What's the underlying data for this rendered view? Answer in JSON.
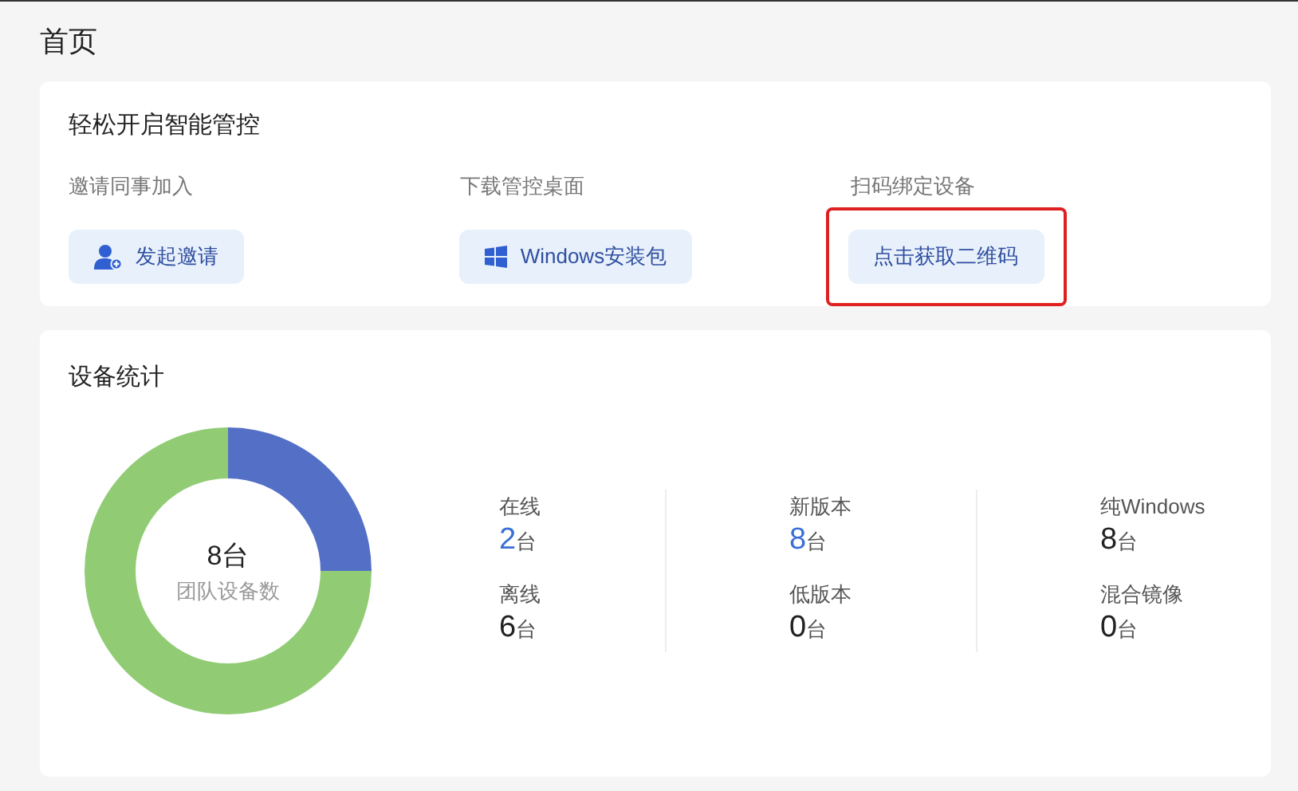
{
  "page_title": "首页",
  "quick_start": {
    "title": "轻松开启智能管控",
    "actions": [
      {
        "label": "邀请同事加入",
        "button": "发起邀请",
        "kind": "invite",
        "highlighted": false
      },
      {
        "label": "下载管控桌面",
        "button": "Windows安装包",
        "kind": "windows",
        "highlighted": false
      },
      {
        "label": "扫码绑定设备",
        "button": "点击获取二维码",
        "kind": "plain",
        "highlighted": true
      }
    ]
  },
  "device_stats": {
    "title": "设备统计",
    "chart_data": {
      "type": "donut",
      "values": [
        25,
        75
      ],
      "colors": [
        "#5470c6",
        "#91cc75"
      ]
    },
    "total": {
      "value": "8",
      "unit": "台",
      "label": "团队设备数"
    },
    "columns": [
      [
        {
          "label": "在线",
          "value": "2",
          "unit": "台",
          "highlight": true
        },
        {
          "label": "离线",
          "value": "6",
          "unit": "台",
          "highlight": false
        }
      ],
      [
        {
          "label": "新版本",
          "value": "8",
          "unit": "台",
          "highlight": true
        },
        {
          "label": "低版本",
          "value": "0",
          "unit": "台",
          "highlight": false
        }
      ],
      [
        {
          "label": "纯Windows",
          "value": "8",
          "unit": "台",
          "highlight": false
        },
        {
          "label": "混合镜像",
          "value": "0",
          "unit": "台",
          "highlight": false
        }
      ]
    ]
  }
}
